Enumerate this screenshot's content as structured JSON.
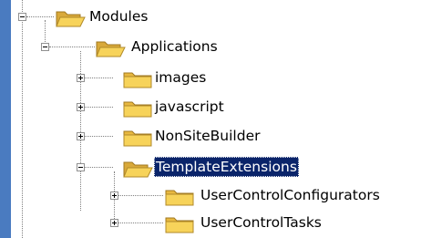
{
  "tree": {
    "nodes": [
      {
        "label": "Modules",
        "expanded": true,
        "icon": "folder-open-icon"
      },
      {
        "label": "Applications",
        "expanded": true,
        "icon": "folder-open-icon"
      },
      {
        "label": "images",
        "expanded": false,
        "icon": "folder-icon"
      },
      {
        "label": "javascript",
        "expanded": false,
        "icon": "folder-icon"
      },
      {
        "label": "NonSiteBuilder",
        "expanded": false,
        "icon": "folder-icon"
      },
      {
        "label": "TemplateExtensions",
        "expanded": true,
        "selected": true,
        "icon": "folder-open-icon"
      },
      {
        "label": "UserControlConfigurators",
        "expanded": false,
        "icon": "folder-icon"
      },
      {
        "label": "UserControlTasks",
        "expanded": false,
        "icon": "folder-icon"
      }
    ]
  },
  "colors": {
    "background": "#4a7bc0",
    "selection": "#0a246a",
    "folder": "#f7d35a"
  }
}
